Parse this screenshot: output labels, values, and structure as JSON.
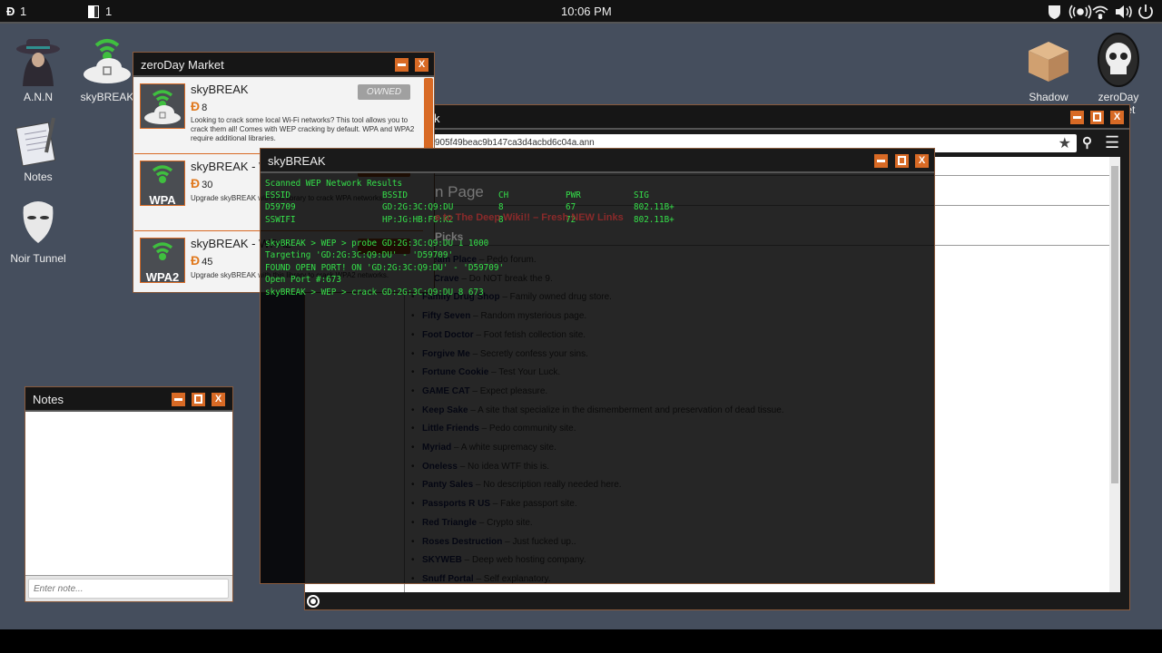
{
  "topbar": {
    "coins": "1",
    "doors": "1",
    "time": "10:06 PM",
    "tray_icons": [
      "shield-skull-icon",
      "broadcast-icon",
      "wifi-icon",
      "volume-icon",
      "power-icon"
    ]
  },
  "desktop": {
    "icons": [
      {
        "label": "A.N.N"
      },
      {
        "label": "skyBREAK"
      },
      {
        "label": "Notes"
      },
      {
        "label": "Noir Tunnel"
      },
      {
        "label": "Shadow Market"
      },
      {
        "label": "zeroDay Market"
      }
    ]
  },
  "market": {
    "title": "zeroDay Market",
    "items": [
      {
        "name": "skyBREAK",
        "price": "8",
        "desc": "Looking to crack some local Wi-Fi networks? This tool allows you to crack them all! Comes with WEP cracking by default. WPA and WPA2 require additional libraries.",
        "button": "OWNED"
      },
      {
        "name": "skyBREAK - WPA",
        "badge": "WPA",
        "price": "30",
        "desc": "Upgrade skyBREAK with this library to crack WPA networks."
      },
      {
        "name": "skyBREAK - WPA2",
        "badge": "WPA2",
        "price": "45",
        "desc": "Upgrade skyBREAK with this library to crack WPA2 networks."
      }
    ]
  },
  "browser": {
    "title_fragment": "k",
    "url_fragment": "905f49beac9b147ca3d4acbd6c04a.ann",
    "heading_fragment": "n Page",
    "welcome_fragment": "e to The Deep Wiki!! – Fresh NEW Links",
    "picks_fragment": "Picks",
    "links": [
      {
        "name": "Dream Place",
        "desc": " – Pedo forum."
      },
      {
        "name": "EnCrave",
        "desc": " – Do NOT break the 9."
      },
      {
        "name": "Family Drug Shop",
        "desc": " – Family owned drug store."
      },
      {
        "name": "Fifty Seven",
        "desc": " – Random mysterious page."
      },
      {
        "name": "Foot Doctor",
        "desc": " – Foot fetish collection site."
      },
      {
        "name": "Forgive Me",
        "desc": " – Secretly confess your sins."
      },
      {
        "name": "Fortune Cookie",
        "desc": " – Test Your Luck."
      },
      {
        "name": "GAME CAT",
        "desc": " – Expect pleasure."
      },
      {
        "name": "Keep Sake",
        "desc": " – A site that specialize in the dismemberment and preservation of dead tissue."
      },
      {
        "name": "Little Friends",
        "desc": " – Pedo community site."
      },
      {
        "name": "Myriad",
        "desc": " – A white supremacy site."
      },
      {
        "name": "Oneless",
        "desc": " – No idea WTF this is."
      },
      {
        "name": "Panty Sales",
        "desc": " – No description really needed here."
      },
      {
        "name": "Passports R US",
        "desc": " – Fake passport site."
      },
      {
        "name": "Red Triangle",
        "desc": " – Crypto site."
      },
      {
        "name": "Roses Destruction",
        "desc": " – Just fucked up.."
      },
      {
        "name": "SKYWEB",
        "desc": " – Deep web hosting company."
      },
      {
        "name": "Snuff Portal",
        "desc": " – Self explanatory."
      }
    ]
  },
  "terminal": {
    "title": "skyBREAK",
    "header": "Scanned WEP Network Results",
    "columns": [
      "ESSID",
      "BSSID",
      "CH",
      "PWR",
      "SIG"
    ],
    "rows": [
      [
        "D59709",
        "GD:2G:3C:Q9:DU",
        "8",
        "67",
        "802.11B+"
      ],
      [
        "SSWIFI",
        "HP:JG:HB:F8:K2",
        "8",
        "72",
        "802.11B+"
      ]
    ],
    "log": [
      "skyBREAK > WEP > probe GD:2G:3C:Q9:DU 1 1000",
      "Targeting 'GD:2G:3C:Q9:DU' - 'D59709'",
      "FOUND OPEN PORT! ON 'GD:2G:3C:Q9:DU' - 'D59709'",
      "Open Port #:673",
      "skyBREAK > WEP > crack GD:2G:3C:Q9:DU 8 673"
    ]
  },
  "notes": {
    "title": "Notes",
    "placeholder": "Enter note..."
  },
  "colors": {
    "accent": "#d86a25",
    "terminal_text": "#35e04a",
    "desktop": "#454e5d"
  }
}
